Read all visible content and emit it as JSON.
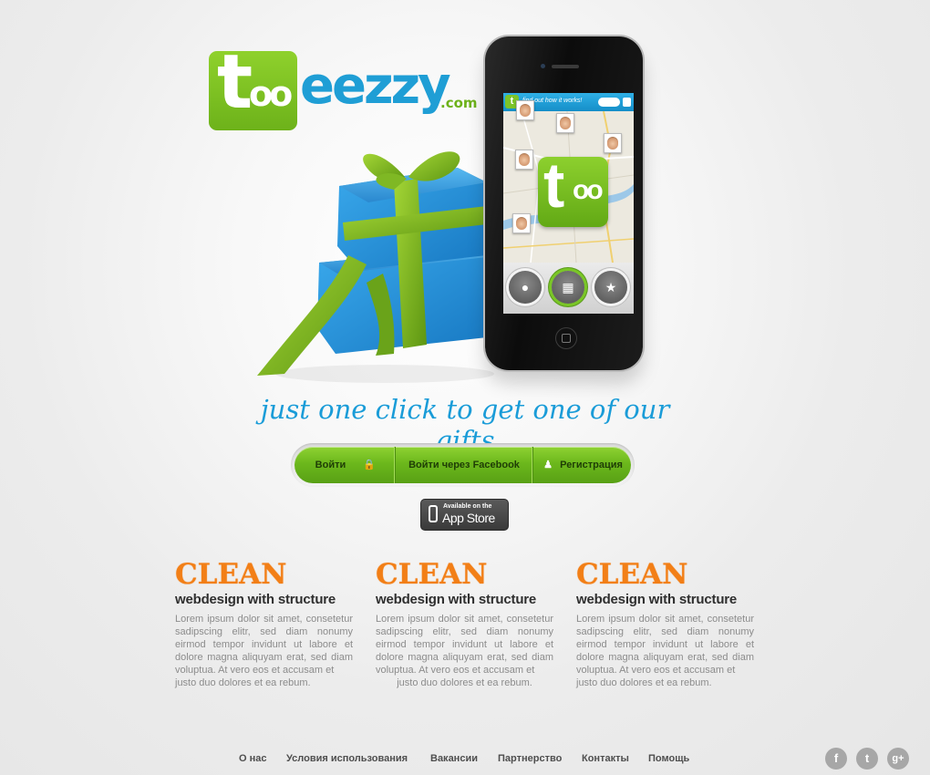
{
  "brand": {
    "logo_box_t": "t",
    "logo_box_oo": "oo",
    "logo_word": "eezzy",
    "logo_domain": ".com",
    "colors": {
      "green": "#7cc42a",
      "blue": "#1f9ed5",
      "orange": "#f27f17"
    }
  },
  "phone": {
    "screen_title": "find out how it works!",
    "screen_logo_t": "t",
    "screen_logo_oo": "oo",
    "dock_icons": [
      "location-pin-icon",
      "gift-icon",
      "badge-star-icon"
    ]
  },
  "tagline": "just one click to get one of our gifts",
  "auth": {
    "login_label": "Войти",
    "facebook_label": "Войти через Facebook",
    "register_label": "Регистрация"
  },
  "appstore": {
    "small": "Available on the",
    "big": "App Store"
  },
  "features": [
    {
      "heading": "CLEAN",
      "subheading": "webdesign with structure",
      "text": "Lorem ipsum dolor sit amet, consetetur sadipscing elitr, sed diam nonumy eirmod tempor invidunt ut labore et dolore magna aliquyam erat, sed diam voluptua. At vero eos et accusam et",
      "text_last": "justo duo dolores et ea rebum."
    },
    {
      "heading": "CLEAN",
      "subheading": "webdesign with structure",
      "text": "Lorem ipsum dolor sit amet, consetetur sadipscing elitr, sed diam nonumy eirmod tempor invidunt ut labore et dolore magna aliquyam erat, sed diam voluptua. At vero eos et accusam et",
      "text_last": "justo duo dolores et ea rebum."
    },
    {
      "heading": "CLEAN",
      "subheading": "webdesign with structure",
      "text": "Lorem ipsum dolor sit amet, consetetur sadipscing elitr, sed diam nonumy eirmod tempor invidunt ut labore et dolore magna aliquyam erat, sed diam voluptua. At vero eos et accusam et",
      "text_last": "justo duo dolores et ea rebum."
    }
  ],
  "footer": {
    "links": [
      "О нас",
      "Условия использования",
      "Вакансии",
      "Партнерство",
      "Контакты",
      "Помощь"
    ],
    "social": [
      {
        "icon": "facebook-icon",
        "glyph": "f"
      },
      {
        "icon": "twitter-icon",
        "glyph": "t"
      },
      {
        "icon": "google-plus-icon",
        "glyph": "g+"
      }
    ]
  }
}
